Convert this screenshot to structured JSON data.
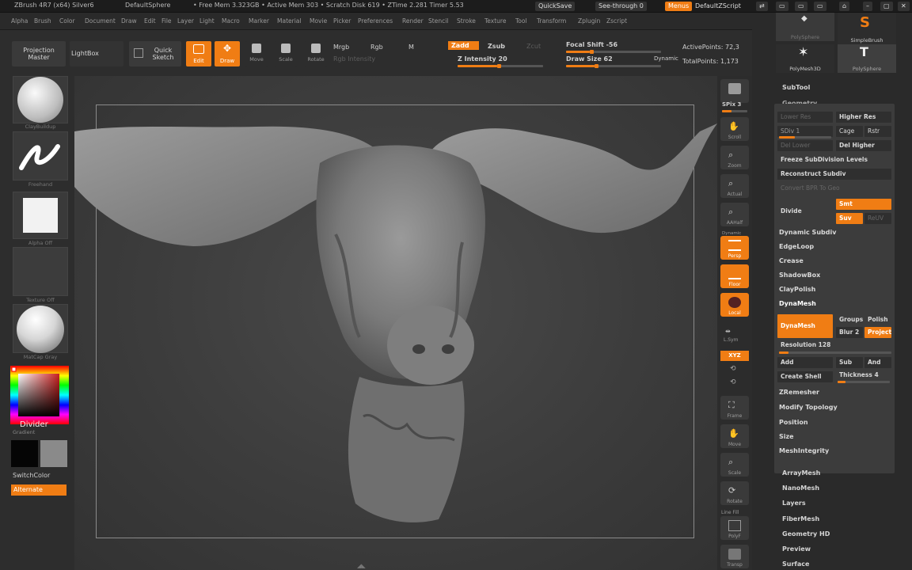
{
  "titlebar": {
    "app": "ZBrush 4R7 (x64) Silver6",
    "project": "DefaultSphere",
    "stats": "• Free Mem 3.323GB • Active Mem 303 • Scratch Disk 619 • ZTime 2.281 Timer 5.53",
    "quicksave": "QuickSave",
    "seethrough": "See-through",
    "seethrough_value": "0",
    "menus": "Menus",
    "script": "DefaultZScript"
  },
  "menus": [
    "Alpha",
    "Brush",
    "Color",
    "Document",
    "Draw",
    "Edit",
    "File",
    "Layer",
    "Light",
    "Macro",
    "Marker",
    "Material",
    "Movie",
    "Picker",
    "Preferences",
    "Render",
    "Stencil",
    "Stroke",
    "Texture",
    "Tool",
    "Transform",
    "Zplugin",
    "Zscript"
  ],
  "toolbar": {
    "projection_master": "Projection Master",
    "lightbox": "LightBox",
    "quick_sketch": "Quick Sketch",
    "edit": "Edit",
    "draw": "Draw",
    "move": "Move",
    "scale": "Scale",
    "rotate": "Rotate",
    "mrgb": "Mrgb",
    "rgb": "Rgb",
    "m": "M",
    "rgb_intensity": "Rgb Intensity",
    "zadd": "Zadd",
    "zsub": "Zsub",
    "zcut": "Zcut",
    "z_intensity_label": "Z Intensity",
    "z_intensity": "20",
    "focal_shift_label": "Focal Shift",
    "focal_shift": "-56",
    "draw_size_label": "Draw Size",
    "draw_size": "62",
    "dynamic": "Dynamic",
    "active_points_label": "ActivePoints:",
    "active_points": "72,3",
    "total_points_label": "TotalPoints:",
    "total_points": "1,173"
  },
  "leftshelf": {
    "brush": "ClayBuildup",
    "stroke": "Freehand",
    "alpha": "Alpha Off",
    "texture": "Texture Off",
    "material": "MatCap Gray",
    "gradient": "Gradient",
    "divider": "Divider",
    "switchcolor": "SwitchColor",
    "alternate": "Alternate"
  },
  "rightshelf": {
    "spix_label": "SPix",
    "spix": "3",
    "scroll": "Scroll",
    "zoom": "Zoom",
    "actual": "Actual",
    "aahalf": "AAHalf",
    "dynamic": "Dynamic",
    "persp": "Persp",
    "floor": "Floor",
    "local": "Local",
    "lsym": "L.Sym",
    "xyz": "XYZ",
    "frame": "Frame",
    "move": "Move",
    "scale": "Scale",
    "rotate": "Rotate",
    "line_fill": "Line Fill",
    "polyf": "PolyF",
    "transp": "Transp"
  },
  "palette": {
    "tool_polysphere_top": "PolySphere",
    "simplebrush": "SimpleBrush",
    "polymesh3d": "PolyMesh3D",
    "polysphere": "PolySphere",
    "subtool": "SubTool",
    "geometry": "Geometry",
    "lower_res": "Lower Res",
    "higher_res": "Higher Res",
    "sdiv_label": "SDiv",
    "sdiv": "1",
    "cage": "Cage",
    "rstr": "Rstr",
    "del_lower": "Del Lower",
    "del_higher": "Del Higher",
    "freeze": "Freeze SubDivision Levels",
    "reconstruct": "Reconstruct Subdiv",
    "convert_bpr": "Convert BPR To Geo",
    "divide": "Divide",
    "smt": "Smt",
    "suv": "Suv",
    "reuv": "ReUV",
    "dynamic_subdiv": "Dynamic Subdiv",
    "edgeloop": "EdgeLoop",
    "crease": "Crease",
    "shadowbox": "ShadowBox",
    "claypolish": "ClayPolish",
    "dynamesh_header": "DynaMesh",
    "dynamesh_btn": "DynaMesh",
    "groups": "Groups",
    "polish": "Polish",
    "blur_label": "Blur",
    "blur": "2",
    "project": "Project",
    "resolution_label": "Resolution",
    "resolution": "128",
    "add": "Add",
    "sub": "Sub",
    "and": "And",
    "create_shell": "Create Shell",
    "thickness_label": "Thickness",
    "thickness": "4",
    "zremesher": "ZRemesher",
    "modify_topology": "Modify Topology",
    "position": "Position",
    "size": "Size",
    "meshintegrity": "MeshIntegrity",
    "arraymesh": "ArrayMesh",
    "nanomesh": "NanoMesh",
    "layers": "Layers",
    "fibermesh": "FiberMesh",
    "geometry_hd": "Geometry HD",
    "preview": "Preview",
    "surface": "Surface"
  },
  "colors": {
    "accent": "#f07d14",
    "panel": "#3c3c3c",
    "bg": "#2b2b2b"
  }
}
